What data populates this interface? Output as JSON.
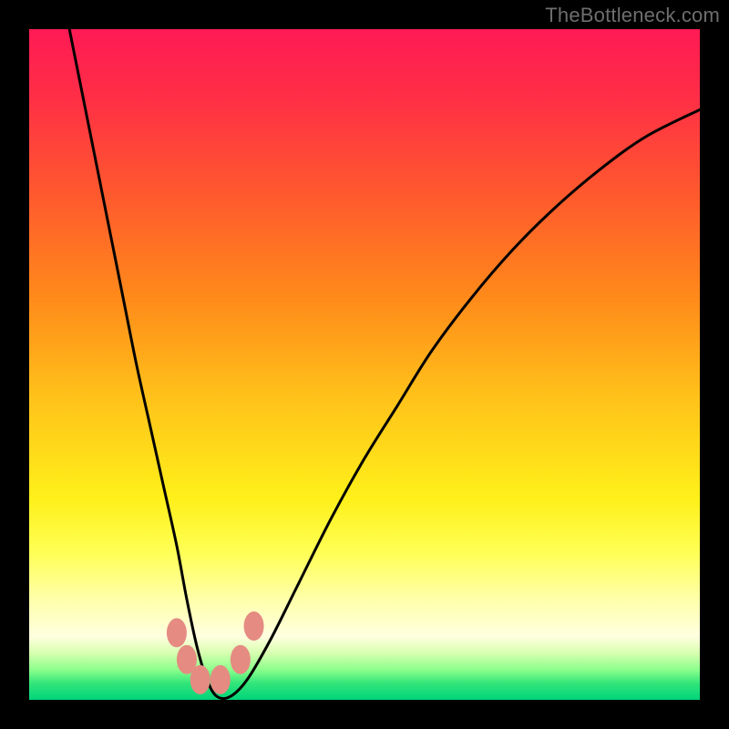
{
  "watermark": "TheBottleneck.com",
  "colors": {
    "frame": "#000000",
    "watermark": "#6e6e6e",
    "curve_stroke": "#000000",
    "marker_fill": "#e58b82",
    "gradient_stops": [
      {
        "offset": 0.0,
        "color": "#ff1a55"
      },
      {
        "offset": 0.1,
        "color": "#ff2e46"
      },
      {
        "offset": 0.25,
        "color": "#ff5a2d"
      },
      {
        "offset": 0.4,
        "color": "#ff8a1a"
      },
      {
        "offset": 0.55,
        "color": "#ffc21a"
      },
      {
        "offset": 0.7,
        "color": "#fff01a"
      },
      {
        "offset": 0.78,
        "color": "#ffff55"
      },
      {
        "offset": 0.85,
        "color": "#ffffaa"
      },
      {
        "offset": 0.905,
        "color": "#ffffe0"
      },
      {
        "offset": 0.93,
        "color": "#d8ffb0"
      },
      {
        "offset": 0.955,
        "color": "#8cff8c"
      },
      {
        "offset": 0.975,
        "color": "#33e67a"
      },
      {
        "offset": 1.0,
        "color": "#00d47a"
      }
    ]
  },
  "chart_data": {
    "type": "line",
    "title": "",
    "xlabel": "",
    "ylabel": "",
    "xlim": [
      0,
      100
    ],
    "ylim": [
      0,
      100
    ],
    "series": [
      {
        "name": "bottleneck-curve",
        "x": [
          6,
          8,
          10,
          12,
          14,
          16,
          18,
          20,
          22,
          23.5,
          25,
          26.5,
          28,
          30,
          32.5,
          36,
          40,
          45,
          50,
          55,
          60,
          66,
          72,
          78,
          85,
          92,
          100
        ],
        "y": [
          100,
          90,
          80,
          70,
          60,
          50,
          41,
          32,
          23,
          15,
          8,
          3,
          0.5,
          0.5,
          3,
          9,
          17,
          27,
          36,
          44,
          52,
          60,
          67,
          73,
          79,
          84,
          88
        ]
      }
    ],
    "markers": [
      {
        "name": "m1",
        "x": 22.0,
        "y": 10.0
      },
      {
        "name": "m2",
        "x": 23.5,
        "y": 6.0
      },
      {
        "name": "m3",
        "x": 25.5,
        "y": 3.0
      },
      {
        "name": "m4",
        "x": 28.5,
        "y": 3.0
      },
      {
        "name": "m5",
        "x": 31.5,
        "y": 6.0
      },
      {
        "name": "m6",
        "x": 33.5,
        "y": 11.0
      }
    ],
    "marker_size_px": {
      "rx": 11,
      "ry": 16
    },
    "annotations": []
  }
}
